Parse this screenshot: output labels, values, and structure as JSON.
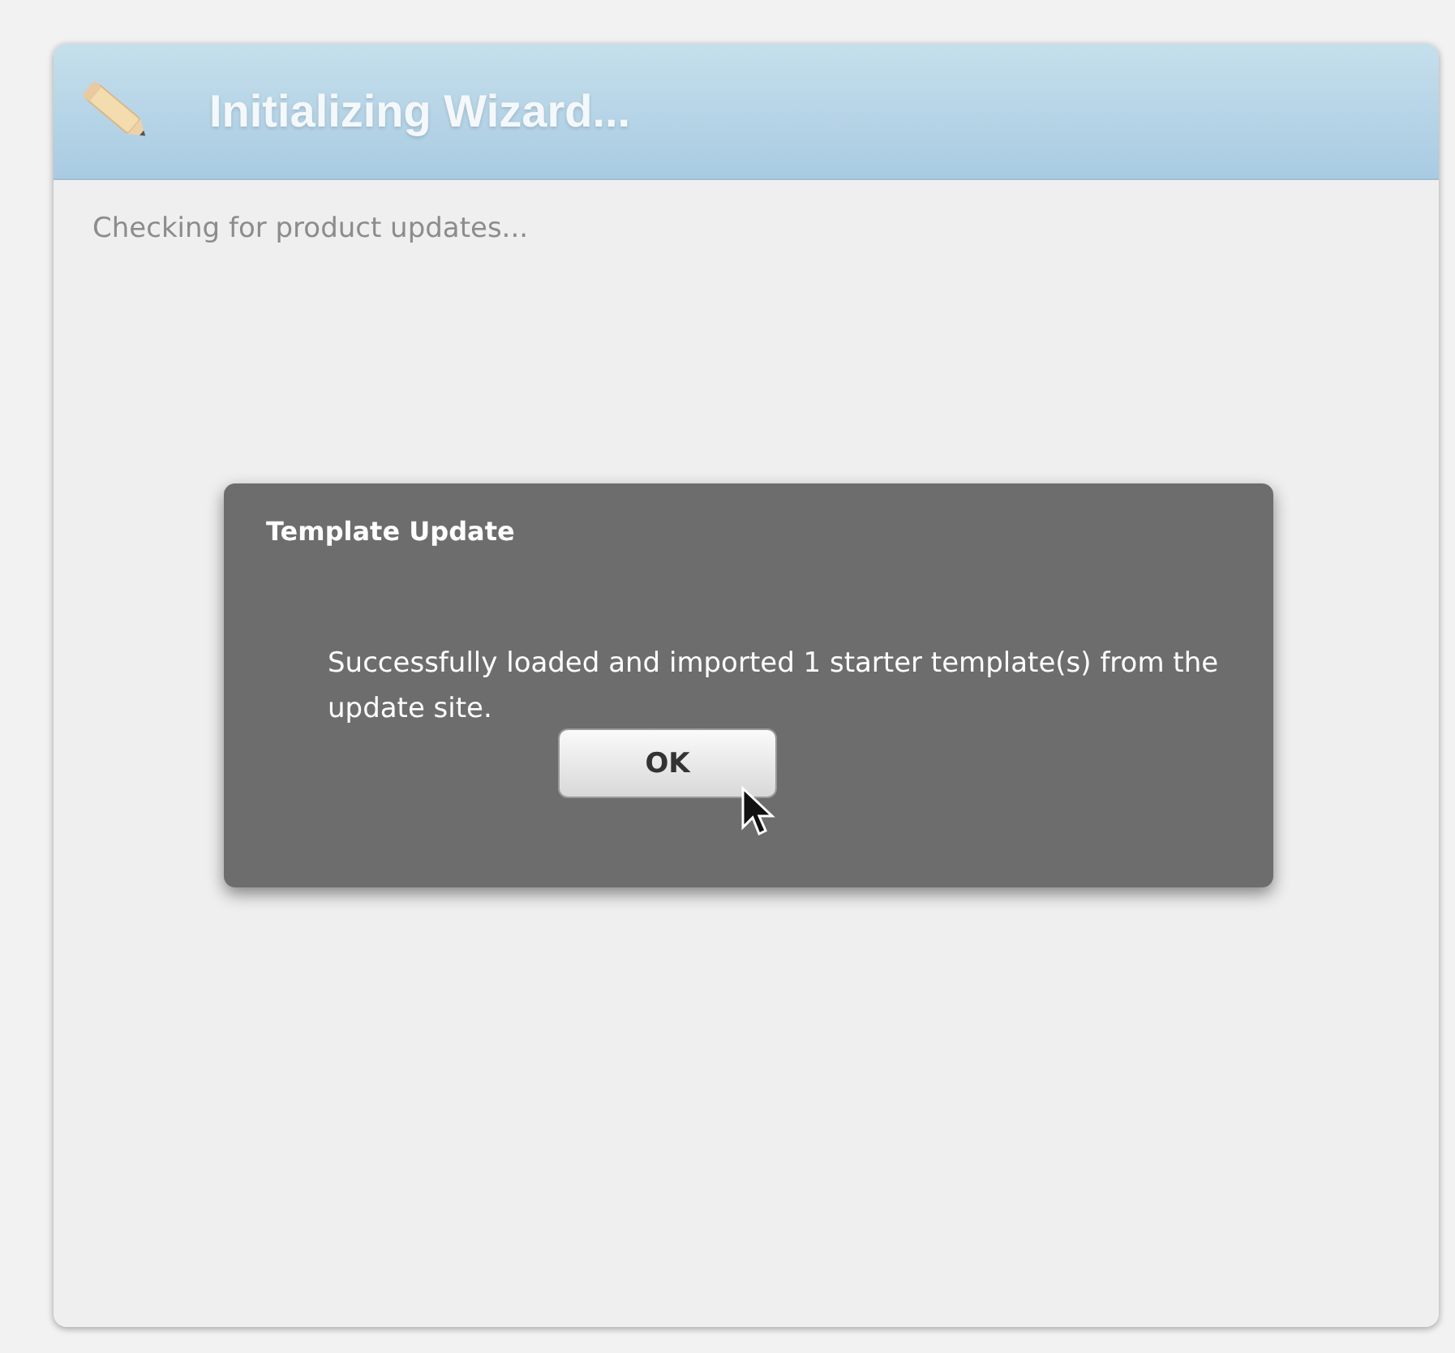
{
  "window": {
    "title": "Initializing Wizard..."
  },
  "status_text": "Checking for product updates...",
  "dialog": {
    "title": "Template Update",
    "message": "Successfully loaded and imported 1 starter template(s) from the update site.",
    "buttons": [
      "OK"
    ]
  }
}
